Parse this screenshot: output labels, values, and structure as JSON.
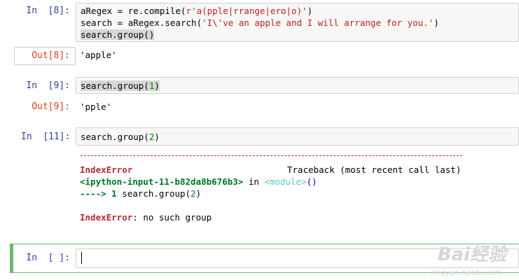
{
  "cells": {
    "c8": {
      "in_prompt": "In  [8]:",
      "out_prompt": "Out[8]:",
      "line1_a": "aRegex = re.compile(",
      "line1_str": "r'a(pple|rrange|ero|o)'",
      "line1_b": ")",
      "line2_a": "search = aRegex.search(",
      "line2_str": "'I\\'ve an apple and I will arrange for you.'",
      "line2_b": ")",
      "line3": "search.group()",
      "output": "'apple'"
    },
    "c9": {
      "in_prompt": "In  [9]:",
      "out_prompt": "Out[9]:",
      "code_a": "search.group(",
      "code_num": "1",
      "code_b": ")",
      "output": "'pple'"
    },
    "c11": {
      "in_prompt": "In  [11]:",
      "code_a": "search.group(",
      "code_num": "2",
      "code_b": ")",
      "tb_error_name": "IndexError",
      "tb_header": "Traceback (most recent call last)",
      "tb_input_ref": "<ipython-input-11-b82da8b676b3>",
      "tb_in": " in ",
      "tb_module": "<module>",
      "tb_parens": "()",
      "tb_arrow": "----> 1",
      "tb_line_a": " search.group(",
      "tb_line_num": "2",
      "tb_line_b": ")",
      "tb_final_name": "IndexError",
      "tb_final_msg": ": no such group"
    },
    "empty": {
      "in_prompt": "In  [ ]:"
    }
  },
  "watermark": {
    "logo": "Bai经验",
    "url": "jingyan.baidu.com"
  },
  "colors": {
    "in_prompt": "#303f9f",
    "out_prompt": "#d84315",
    "string": "#ba2121",
    "number": "#008000",
    "error": "#b22b31",
    "edit_border": "#66bb6a"
  }
}
